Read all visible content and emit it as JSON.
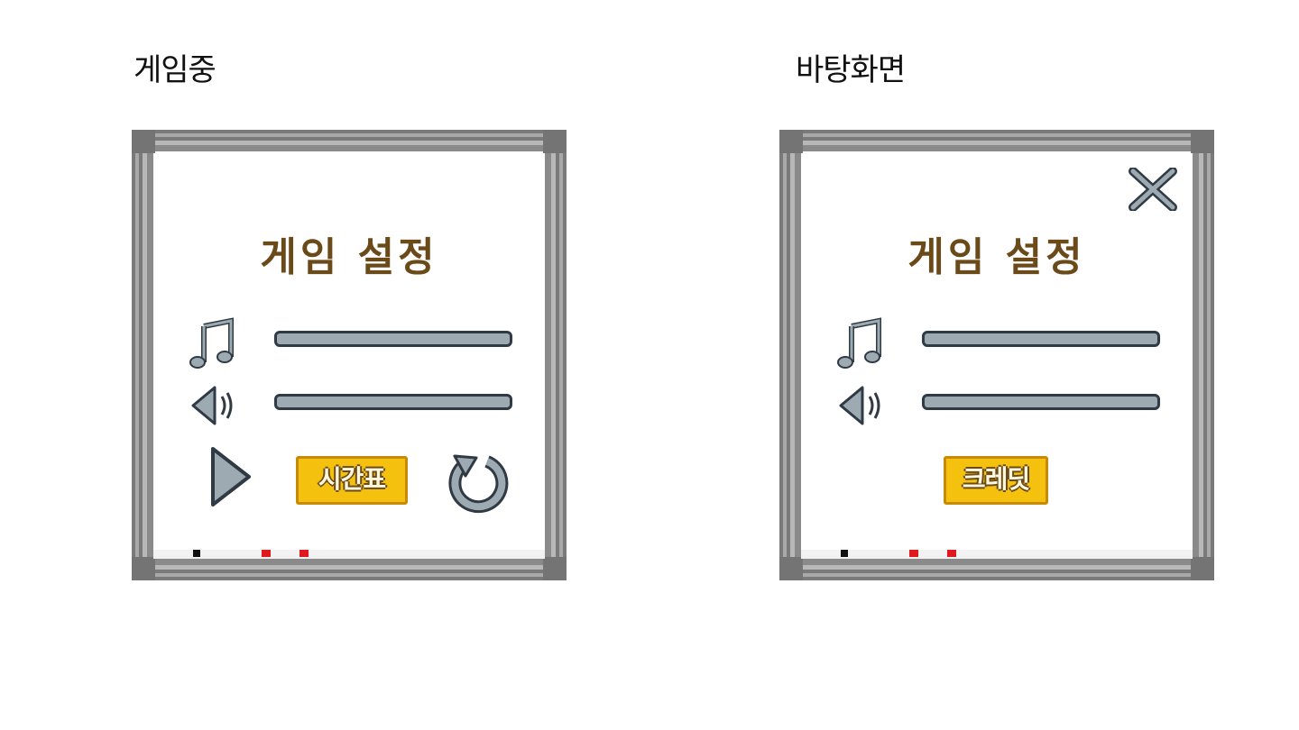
{
  "captions": {
    "left": "게임중",
    "right": "바탕화면"
  },
  "left_panel": {
    "title": "게임 설정",
    "music_icon": "music-note-icon",
    "sound_icon": "speaker-icon",
    "music_volume": 1.0,
    "sound_volume": 1.0,
    "play_icon": "play-icon",
    "timetable_label": "시간표",
    "restart_icon": "restart-icon"
  },
  "right_panel": {
    "title": "게임 설정",
    "close_icon": "close-icon",
    "music_icon": "music-note-icon",
    "sound_icon": "speaker-icon",
    "music_volume": 1.0,
    "sound_volume": 1.0,
    "credit_label": "크레딧"
  },
  "colors": {
    "title": "#6b4a1a",
    "button_fill": "#f4c10f",
    "track_fill": "#9eaab2",
    "frame": "#7c7c7c",
    "icon": "#8a979f"
  }
}
